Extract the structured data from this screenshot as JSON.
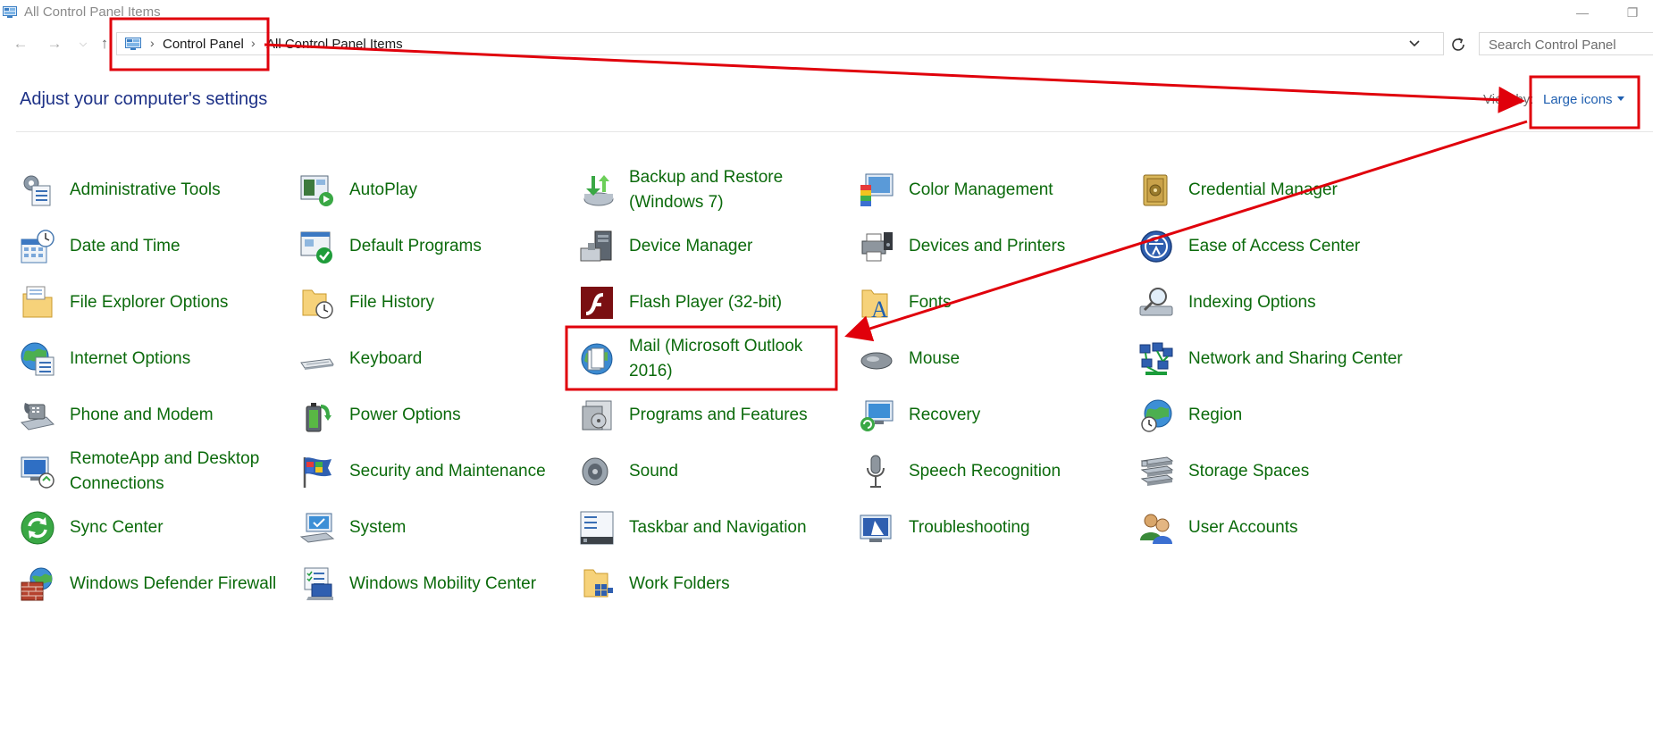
{
  "window": {
    "title": "All Control Panel Items"
  },
  "address": {
    "breadcrumbs": [
      "Control Panel",
      "All Control Panel Items"
    ],
    "search_placeholder": "Search Control Panel"
  },
  "header": {
    "title": "Adjust your computer's settings",
    "view_by_label": "View by:",
    "view_by_value": "Large icons"
  },
  "items": [
    {
      "label": "Administrative Tools",
      "icon": "administrative-tools-icon"
    },
    {
      "label": "AutoPlay",
      "icon": "autoplay-icon"
    },
    {
      "label": "Backup and Restore (Windows 7)",
      "icon": "backup-restore-icon"
    },
    {
      "label": "Color Management",
      "icon": "color-management-icon"
    },
    {
      "label": "Credential Manager",
      "icon": "credential-manager-icon"
    },
    {
      "label": "Date and Time",
      "icon": "date-time-icon"
    },
    {
      "label": "Default Programs",
      "icon": "default-programs-icon"
    },
    {
      "label": "Device Manager",
      "icon": "device-manager-icon"
    },
    {
      "label": "Devices and Printers",
      "icon": "devices-printers-icon"
    },
    {
      "label": "Ease of Access Center",
      "icon": "ease-of-access-icon"
    },
    {
      "label": "File Explorer Options",
      "icon": "file-explorer-options-icon"
    },
    {
      "label": "File History",
      "icon": "file-history-icon"
    },
    {
      "label": "Flash Player (32-bit)",
      "icon": "flash-player-icon"
    },
    {
      "label": "Fonts",
      "icon": "fonts-icon"
    },
    {
      "label": "Indexing Options",
      "icon": "indexing-options-icon"
    },
    {
      "label": "Internet Options",
      "icon": "internet-options-icon"
    },
    {
      "label": "Keyboard",
      "icon": "keyboard-icon"
    },
    {
      "label": "Mail (Microsoft Outlook 2016)",
      "icon": "mail-icon"
    },
    {
      "label": "Mouse",
      "icon": "mouse-icon"
    },
    {
      "label": "Network and Sharing Center",
      "icon": "network-sharing-icon"
    },
    {
      "label": "Phone and Modem",
      "icon": "phone-modem-icon"
    },
    {
      "label": "Power Options",
      "icon": "power-options-icon"
    },
    {
      "label": "Programs and Features",
      "icon": "programs-features-icon"
    },
    {
      "label": "Recovery",
      "icon": "recovery-icon"
    },
    {
      "label": "Region",
      "icon": "region-icon"
    },
    {
      "label": "RemoteApp and Desktop Connections",
      "icon": "remoteapp-icon"
    },
    {
      "label": "Security and Maintenance",
      "icon": "security-maintenance-icon"
    },
    {
      "label": "Sound",
      "icon": "sound-icon"
    },
    {
      "label": "Speech Recognition",
      "icon": "speech-recognition-icon"
    },
    {
      "label": "Storage Spaces",
      "icon": "storage-spaces-icon"
    },
    {
      "label": "Sync Center",
      "icon": "sync-center-icon"
    },
    {
      "label": "System",
      "icon": "system-icon"
    },
    {
      "label": "Taskbar and Navigation",
      "icon": "taskbar-navigation-icon"
    },
    {
      "label": "Troubleshooting",
      "icon": "troubleshooting-icon"
    },
    {
      "label": "User Accounts",
      "icon": "user-accounts-icon"
    },
    {
      "label": "Windows Defender Firewall",
      "icon": "firewall-icon"
    },
    {
      "label": "Windows Mobility Center",
      "icon": "mobility-center-icon"
    },
    {
      "label": "Work Folders",
      "icon": "work-folders-icon"
    }
  ],
  "colors": {
    "item_link": "#0b6a0b",
    "heading": "#1e3287",
    "view_by_link": "#1f5fb0",
    "annotation": "#e0000b"
  }
}
